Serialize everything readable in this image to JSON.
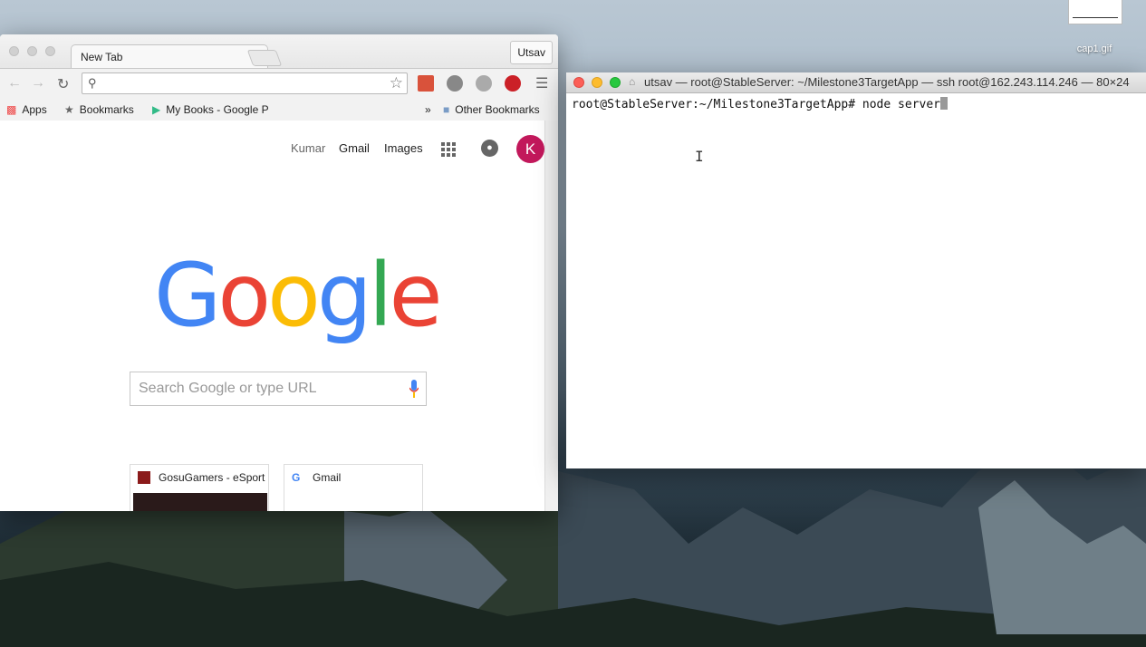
{
  "desktop": {
    "file_label": "cap1.gif"
  },
  "chrome": {
    "tab_title": "New Tab",
    "tab_close": "×",
    "profile_name": "Utsav",
    "omnibox_value": "",
    "bookmarks": {
      "apps": "Apps",
      "bookmarks": "Bookmarks",
      "my_books": "My Books - Google P",
      "overflow": "»",
      "other": "Other Bookmarks"
    },
    "ntp": {
      "links": [
        "Kumar",
        "Gmail",
        "Images"
      ],
      "avatar_letter": "K",
      "logo": [
        "G",
        "o",
        "o",
        "g",
        "l",
        "e"
      ],
      "logo_colors": [
        "#4285F4",
        "#EA4335",
        "#FBBC05",
        "#4285F4",
        "#34A853",
        "#EA4335"
      ],
      "search_placeholder": "Search Google or type URL",
      "tiles": [
        {
          "title": "GosuGamers - eSport"
        },
        {
          "title": "Gmail"
        }
      ]
    }
  },
  "terminal": {
    "title": "utsav — root@StableServer: ~/Milestone3TargetApp — ssh root@162.243.114.246 — 80×24",
    "prompt": "root@StableServer:~/Milestone3TargetApp# ",
    "command": "node server"
  }
}
